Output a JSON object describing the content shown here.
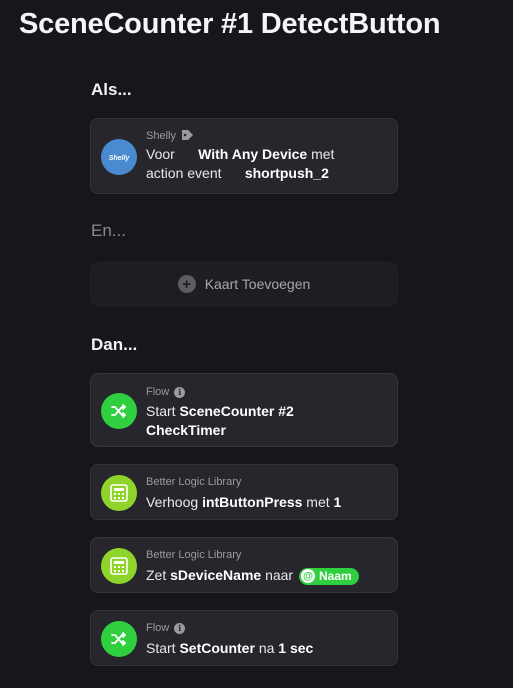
{
  "page": {
    "title": "SceneCounter #1 DetectButton"
  },
  "sections": {
    "when": "Als...",
    "and": "En...",
    "then": "Dan..."
  },
  "when_card": {
    "app": "Shelly",
    "icon": "shelly-logo-icon",
    "voor": "Voor",
    "device": "With Any Device",
    "met": "met",
    "action_event": "action event",
    "event_value": "shortpush_2",
    "color": "#4a8ad0"
  },
  "add_card": {
    "label": "Kaart Toevoegen",
    "icon": "plus-icon"
  },
  "then_cards": [
    {
      "app": "Flow",
      "icon": "shuffle-icon",
      "start": "Start",
      "flow_name": "SceneCounter #2 CheckTimer",
      "color": "#2fcf3f"
    },
    {
      "app": "Better Logic Library",
      "icon": "calculator-icon",
      "verb": "Verhoog",
      "variable": "intButtonPress",
      "met": "met",
      "amount": "1",
      "color": "#8fd42a"
    },
    {
      "app": "Better Logic Library",
      "icon": "calculator-icon",
      "verb": "Zet",
      "variable": "sDeviceName",
      "naar": "naar",
      "tag_label": "Naam",
      "color": "#8fd42a"
    },
    {
      "app": "Flow",
      "icon": "shuffle-icon",
      "start": "Start",
      "flow_name": "SetCounter",
      "na": "na",
      "delay": "1 sec",
      "color": "#2fcf3f"
    }
  ]
}
